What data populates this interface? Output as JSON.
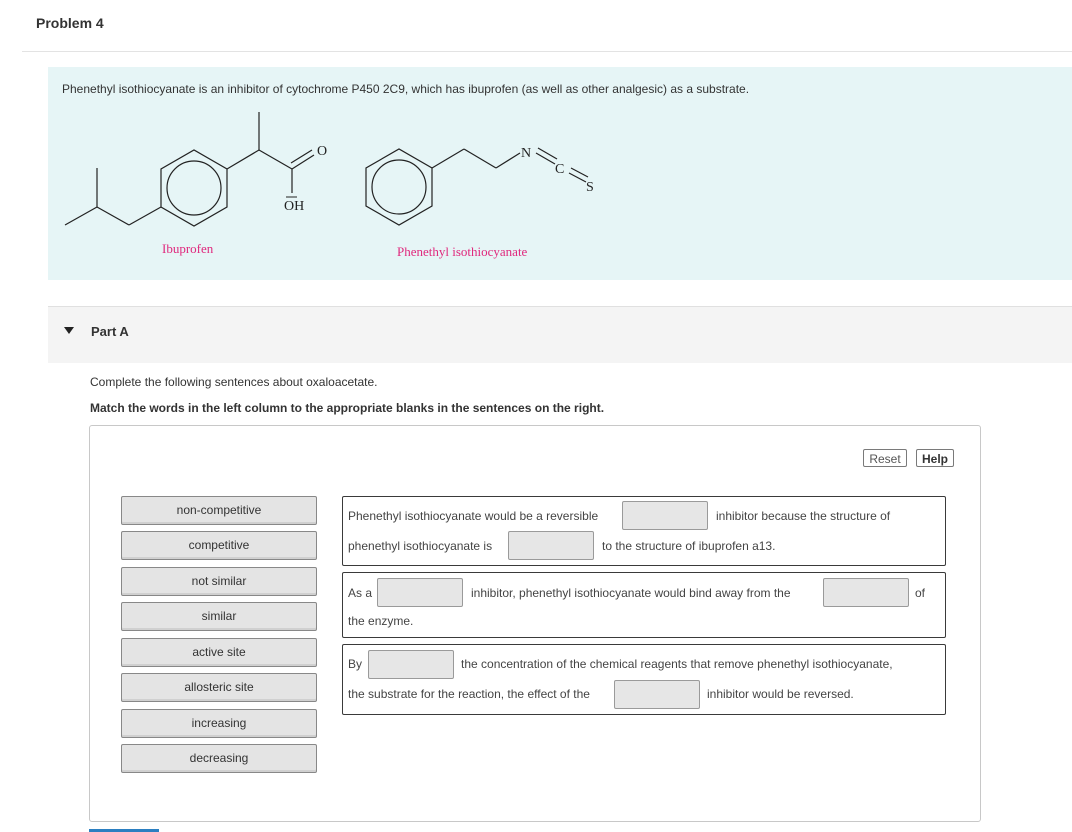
{
  "problem": {
    "title": "Problem 4"
  },
  "intro": {
    "text": "Phenethyl isothiocyanate is an inhibitor of cytochrome P450 2C9, which has ibuprofen (as well as other analgesic) as a substrate.",
    "molecules": [
      {
        "name": "Ibuprofen",
        "atom_labels": [
          "O",
          "OH"
        ]
      },
      {
        "name": "Phenethyl isothiocyanate",
        "atom_labels": [
          "N",
          "C",
          "S"
        ]
      }
    ],
    "label_color": "#e0287d",
    "background_color": "#e6f5f6"
  },
  "part": {
    "label": "Part A",
    "expanded_icon": "triangle-down-icon"
  },
  "instructions": {
    "text": "Complete the following sentences about oxaloacetate.",
    "bold": "Match the words in the left column to the appropriate blanks in the sentences on the right."
  },
  "toolbar": {
    "reset_label": "Reset",
    "help_label": "Help"
  },
  "words": [
    "non-competitive",
    "competitive",
    "not similar",
    "similar",
    "active site",
    "allosteric site",
    "increasing",
    "decreasing"
  ],
  "sentences": [
    {
      "line1_a": "Phenethyl isothiocyanate would be a reversible",
      "line1_b": "inhibitor because the structure of",
      "line2_a": "phenethyl isothiocyanate is",
      "line2_b": "to the structure of ibuprofen a13."
    },
    {
      "line1_a": "As a",
      "line1_b": "inhibitor, phenethyl isothiocyanate would bind away from the",
      "line1_c": "of",
      "line2_a": "the enzyme."
    },
    {
      "line1_a": "By",
      "line1_b": "the concentration of the chemical reagents that remove phenethyl isothiocyanate,",
      "line2_a": "the substrate for the reaction, the effect of the",
      "line2_b": "inhibitor would be reversed."
    }
  ]
}
